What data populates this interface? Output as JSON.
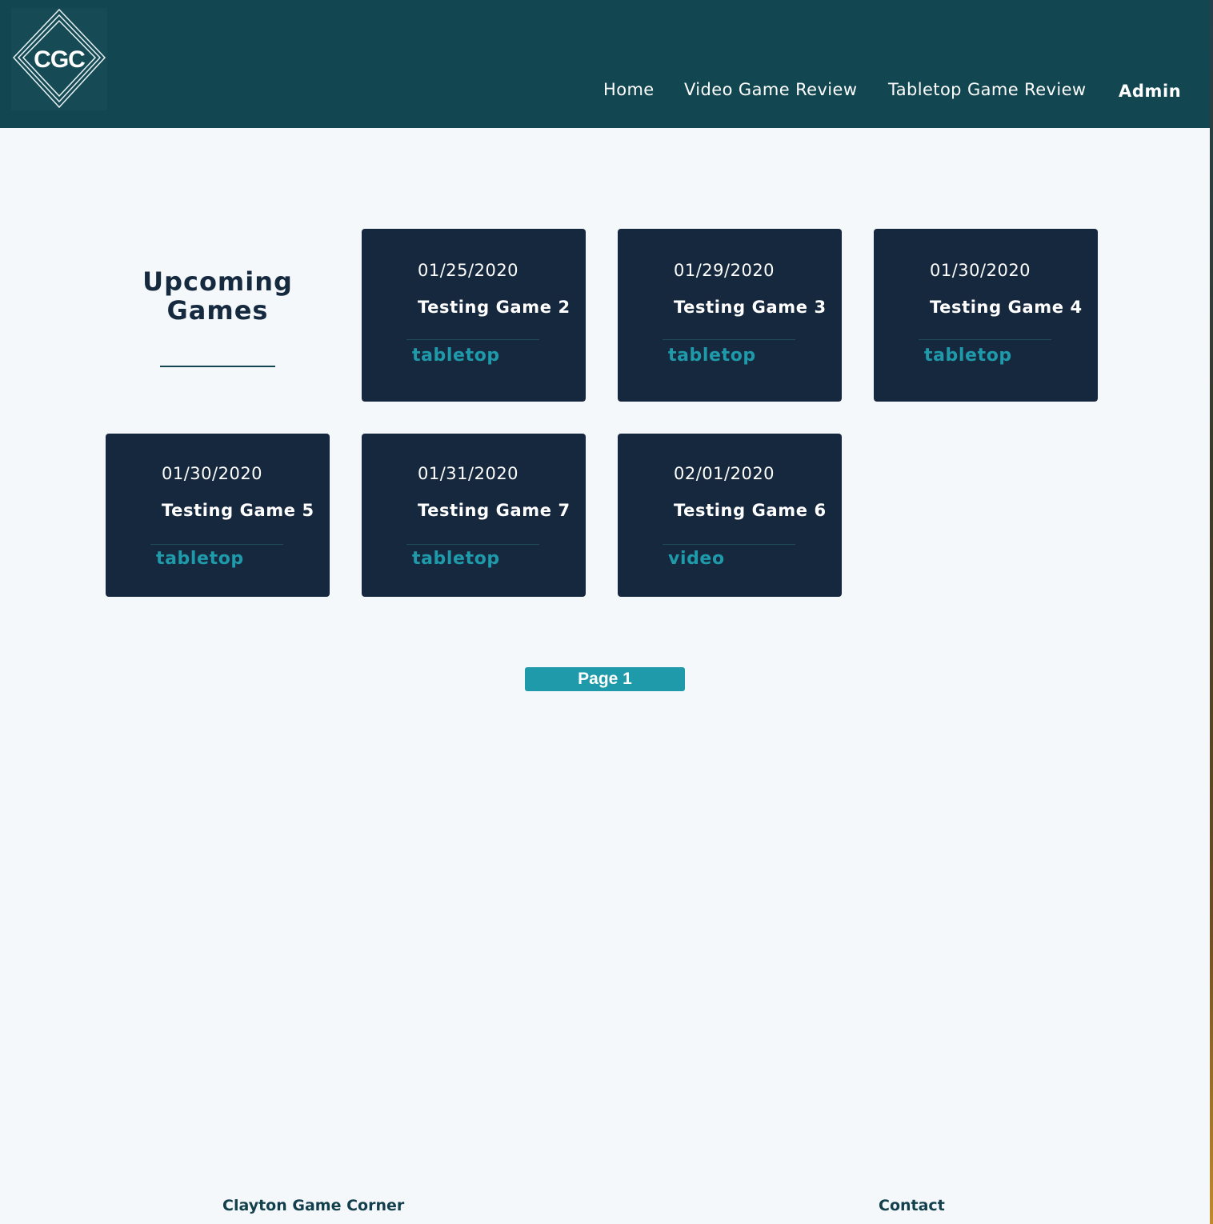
{
  "header": {
    "logo_text": "CGC",
    "nav": [
      {
        "label": "Home"
      },
      {
        "label": "Video Game Review"
      },
      {
        "label": "Tabletop Game Review"
      },
      {
        "label": "Admin"
      }
    ]
  },
  "main": {
    "section_title_line1": "Upcoming",
    "section_title_line2": "Games",
    "cards": [
      {
        "date": "01/25/2020",
        "title": "Testing Game 2",
        "category": "tabletop"
      },
      {
        "date": "01/29/2020",
        "title": "Testing Game 3",
        "category": "tabletop"
      },
      {
        "date": "01/30/2020",
        "title": "Testing Game 4",
        "category": "tabletop"
      },
      {
        "date": "01/30/2020",
        "title": "Testing Game 5",
        "category": "tabletop"
      },
      {
        "date": "01/31/2020",
        "title": "Testing Game 7",
        "category": "tabletop"
      },
      {
        "date": "02/01/2020",
        "title": "Testing Game 6",
        "category": "video"
      }
    ],
    "pagination_label": "Page 1"
  },
  "footer": {
    "site_name": "Clayton Game Corner",
    "contact_label": "Contact"
  },
  "colors": {
    "header_bg": "#124651",
    "card_bg": "#16283d",
    "accent": "#1e9aaa",
    "page_bg": "#f4f8fa",
    "title_text": "#15293f"
  }
}
